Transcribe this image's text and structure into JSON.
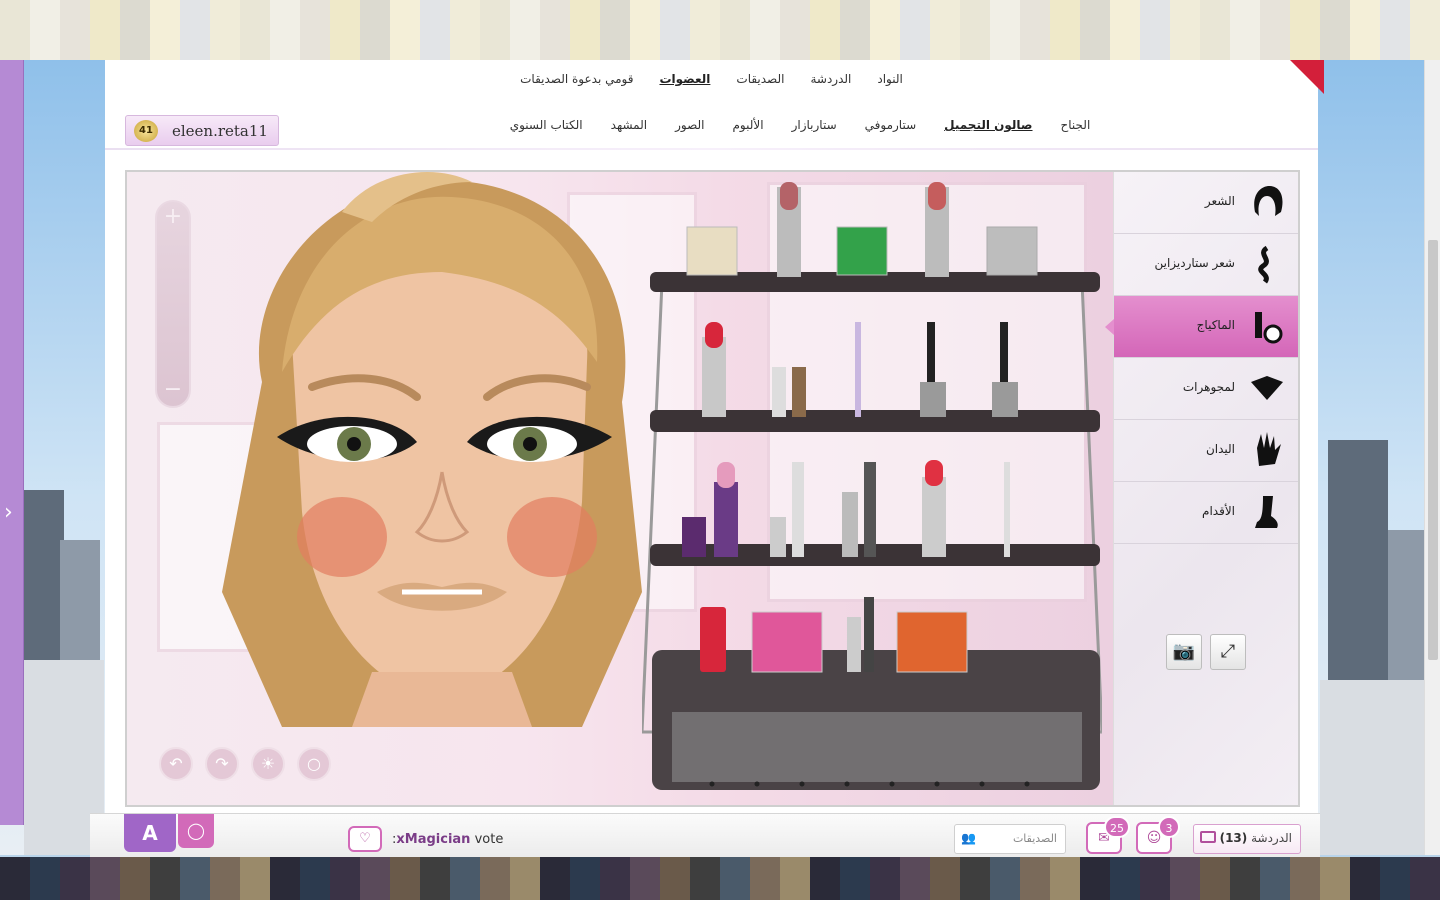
{
  "nav_primary": [
    "النواد",
    "الدردشة",
    "الصديقات",
    "العضوات",
    "قومي بدعوة الصديقات"
  ],
  "nav_primary_active": 3,
  "nav_secondary": [
    "الجناح",
    "صالون التجميل",
    "ستارموفي",
    "ستاربازار",
    "الألبوم",
    "الصور",
    "المشهد",
    "الكتاب السنوي"
  ],
  "nav_secondary_active": 1,
  "user": {
    "level": "41",
    "name": "eleen.reta11"
  },
  "categories": [
    {
      "label": "الشعر",
      "icon": "hair-icon"
    },
    {
      "label": "شعر ستارديزاين",
      "icon": "hair-design-icon"
    },
    {
      "label": "الماكياج",
      "icon": "makeup-icon"
    },
    {
      "label": "لمجوهرات",
      "icon": "jewelry-icon"
    },
    {
      "label": "اليدان",
      "icon": "hand-icon"
    },
    {
      "label": "الأقدام",
      "icon": "foot-icon"
    }
  ],
  "category_active": 2,
  "zoom": {
    "plus": "+",
    "minus": "−"
  },
  "bottom": {
    "logo": "A",
    "vote_user": "xMagician",
    "vote_suffix": ":",
    "vote_label": "vote",
    "friends_placeholder": "الصديقات",
    "mail_count": "25",
    "notif_count": "3",
    "chat_label": "الدردشة",
    "chat_count": "(13)"
  },
  "colors": {
    "accent_pink": "#d26ab9",
    "accent_purple": "#a066c7",
    "ribbon": "#d31f3a"
  }
}
